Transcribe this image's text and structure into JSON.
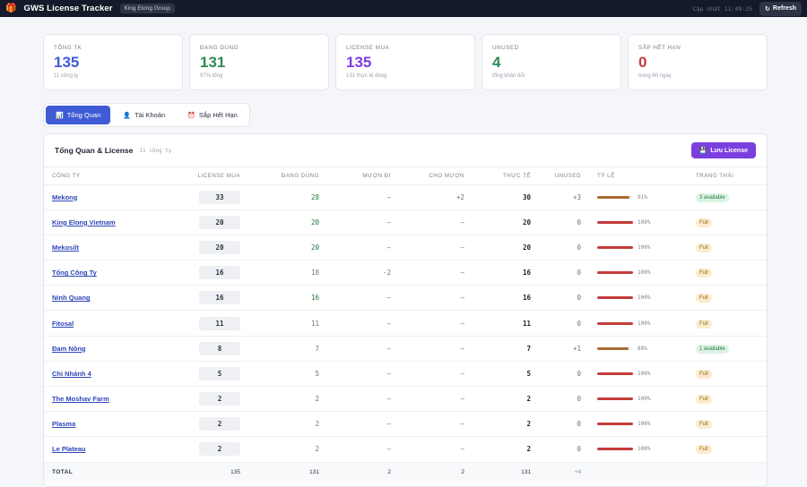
{
  "topbar": {
    "icon": "gift-icon",
    "title": "GWS License Tracker",
    "org": "King Elong Group",
    "updated": "Cập nhật 11:49:25",
    "refresh_label": "Refresh"
  },
  "stats": [
    {
      "label": "Tổng TK",
      "value": "135",
      "sub": "11 công ty",
      "color": "#3f5bd6"
    },
    {
      "label": "Đang dùng",
      "value": "131",
      "sub": "97% tổng",
      "color": "#2f8a55"
    },
    {
      "label": "License mua",
      "value": "135",
      "sub": "131 thực tế dùng",
      "color": "#7b3fe0"
    },
    {
      "label": "Unused",
      "value": "4",
      "sub": "tổng khán dỗi",
      "color": "#2f8a55"
    },
    {
      "label": "Sắp hết hạn",
      "value": "0",
      "sub": "trong 60 ngày",
      "color": "#c43b3b"
    }
  ],
  "tabs": [
    {
      "label": "Tổng Quan",
      "icon": "chart-icon",
      "active": true
    },
    {
      "label": "Tài Khoản",
      "icon": "user-icon",
      "active": false
    },
    {
      "label": "Sắp Hết Hạn",
      "icon": "alarm-icon",
      "active": false
    }
  ],
  "panel": {
    "title": "Tổng Quan & License",
    "subtitle": "11 công ty",
    "save_label": "Lưu License"
  },
  "table": {
    "headers": [
      "Công ty",
      "License mua",
      "Đang dùng",
      "Mượn đi",
      "Cho mượn",
      "Thực tế",
      "Unused",
      "Tỷ lệ",
      "Trạng thái"
    ],
    "rows": [
      {
        "company": "Mekong",
        "license": "33",
        "using": "28",
        "using_green": true,
        "borrow": "–",
        "lend": "+2",
        "actual": "30",
        "unused": "+3",
        "ratio": 91,
        "pct": "91%",
        "status": "3 available",
        "status_type": "avail"
      },
      {
        "company": "King Elong Vietnam",
        "license": "20",
        "using": "20",
        "using_green": true,
        "borrow": "–",
        "lend": "–",
        "actual": "20",
        "unused": "0",
        "ratio": 100,
        "pct": "100%",
        "status": "Full",
        "status_type": "full"
      },
      {
        "company": "Mekosilt",
        "license": "20",
        "using": "20",
        "using_green": true,
        "borrow": "–",
        "lend": "–",
        "actual": "20",
        "unused": "0",
        "ratio": 100,
        "pct": "100%",
        "status": "Full",
        "status_type": "full"
      },
      {
        "company": "Tổng Công Ty",
        "license": "16",
        "using": "18",
        "using_green": false,
        "borrow": "-2",
        "lend": "–",
        "actual": "16",
        "unused": "0",
        "ratio": 100,
        "pct": "100%",
        "status": "Full",
        "status_type": "full"
      },
      {
        "company": "Ninh Quang",
        "license": "16",
        "using": "16",
        "using_green": true,
        "borrow": "–",
        "lend": "–",
        "actual": "16",
        "unused": "0",
        "ratio": 100,
        "pct": "100%",
        "status": "Full",
        "status_type": "full"
      },
      {
        "company": "Fitosal",
        "license": "11",
        "using": "11",
        "using_green": false,
        "borrow": "–",
        "lend": "–",
        "actual": "11",
        "unused": "0",
        "ratio": 100,
        "pct": "100%",
        "status": "Full",
        "status_type": "full"
      },
      {
        "company": "Đam Nông",
        "license": "8",
        "using": "7",
        "using_green": false,
        "borrow": "–",
        "lend": "–",
        "actual": "7",
        "unused": "+1",
        "ratio": 88,
        "pct": "88%",
        "status": "1 available",
        "status_type": "avail"
      },
      {
        "company": "Chi Nhánh 4",
        "license": "5",
        "using": "5",
        "using_green": false,
        "borrow": "–",
        "lend": "–",
        "actual": "5",
        "unused": "0",
        "ratio": 100,
        "pct": "100%",
        "status": "Full",
        "status_type": "full"
      },
      {
        "company": "The Moshav Farm",
        "license": "2",
        "using": "2",
        "using_green": false,
        "borrow": "–",
        "lend": "–",
        "actual": "2",
        "unused": "0",
        "ratio": 100,
        "pct": "100%",
        "status": "Full",
        "status_type": "full"
      },
      {
        "company": "Plasma",
        "license": "2",
        "using": "2",
        "using_green": false,
        "borrow": "–",
        "lend": "–",
        "actual": "2",
        "unused": "0",
        "ratio": 100,
        "pct": "100%",
        "status": "Full",
        "status_type": "full"
      },
      {
        "company": "Le Plateau",
        "license": "2",
        "using": "2",
        "using_green": false,
        "borrow": "–",
        "lend": "–",
        "actual": "2",
        "unused": "0",
        "ratio": 100,
        "pct": "100%",
        "status": "Full",
        "status_type": "full"
      }
    ],
    "total": {
      "label": "TOTAL",
      "license": "135",
      "using": "131",
      "borrow": "2",
      "lend": "2",
      "actual": "131",
      "unused": "+4"
    }
  },
  "colors": {
    "bar_full": "#c43b3b",
    "bar_partial": "#a86a2f",
    "accent": "#3f5bd6",
    "purple": "#7b3fe0"
  }
}
